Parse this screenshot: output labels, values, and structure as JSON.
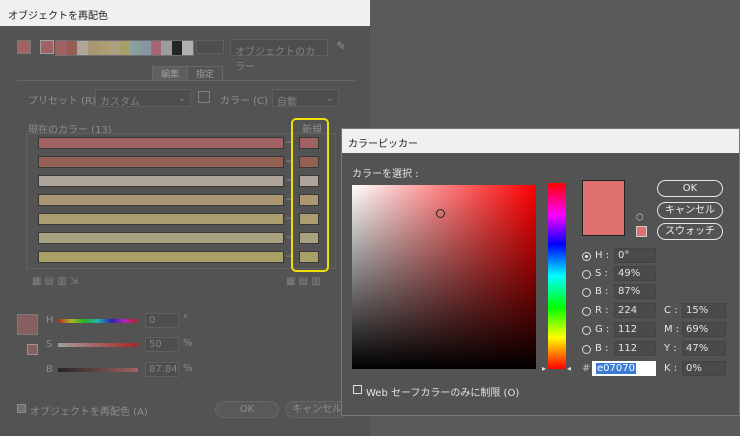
{
  "recolor": {
    "title": "オブジェクトを再配色",
    "color_group_label": "オブジェクトのカラー",
    "tabs": [
      "編集",
      "指定"
    ],
    "preset_label": "プリセット (R) :",
    "preset_value": "カスタム",
    "colors_label": "カラー (C) :",
    "colors_value": "自動",
    "current_colors_label": "現在のカラー (13)",
    "new_label": "新規",
    "rows": [
      {
        "current": "#e07070",
        "new": "#e07070"
      },
      {
        "current": "#c96e54",
        "new": "#c96e54"
      },
      {
        "current": "#fbe8d5",
        "new": "#fbe8d5"
      },
      {
        "current": "#f5cf8f",
        "new": "#f5cf8f"
      },
      {
        "current": "#f3da86",
        "new": "#f3da86"
      },
      {
        "current": "#f0e3a6",
        "new": "#f0e3a6"
      },
      {
        "current": "#f0e07a",
        "new": "#f0e07a"
      }
    ],
    "strip_colors": [
      "#e07070",
      "#c96e54",
      "#fbe8d5",
      "#f5cf8f",
      "#f3da86",
      "#f0e3a6",
      "#f0e07a",
      "#b3e1df",
      "#b8cce4",
      "#e8758a",
      "#d9d9d9",
      "#000000",
      "#ffffff"
    ],
    "hsb": {
      "h_label": "H",
      "h_value": "0",
      "h_unit": "°",
      "s_label": "S",
      "s_value": "50",
      "s_unit": "%",
      "b_label": "B",
      "b_value": "87.84",
      "b_unit": "%"
    },
    "recolor_checkbox_label": "オブジェクトを再配色 (A)",
    "ok_label": "OK",
    "cancel_label": "キャンセル"
  },
  "picker": {
    "title": "カラーピッカー",
    "select_label": "カラーを選択 :",
    "ok_label": "OK",
    "cancel_label": "キャンセル",
    "swatches_label": "スウォッチ",
    "preview_color": "#e07070",
    "fields": {
      "H": {
        "label": "H :",
        "value": "0°"
      },
      "S": {
        "label": "S :",
        "value": "49%"
      },
      "B": {
        "label": "B :",
        "value": "87%"
      },
      "R": {
        "label": "R :",
        "value": "224"
      },
      "G": {
        "label": "G :",
        "value": "112"
      },
      "Bl": {
        "label": "B :",
        "value": "112"
      },
      "C": {
        "label": "C :",
        "value": "15%"
      },
      "M": {
        "label": "M :",
        "value": "69%"
      },
      "Y": {
        "label": "Y :",
        "value": "47%"
      },
      "K": {
        "label": "K :",
        "value": "0%"
      }
    },
    "hex_label": "#",
    "hex_value": "e07070",
    "websafe_label": "Web セーフカラーのみに制限 (O)"
  },
  "colors": {
    "highlight": "#f0e000",
    "accent": "#e07070"
  }
}
